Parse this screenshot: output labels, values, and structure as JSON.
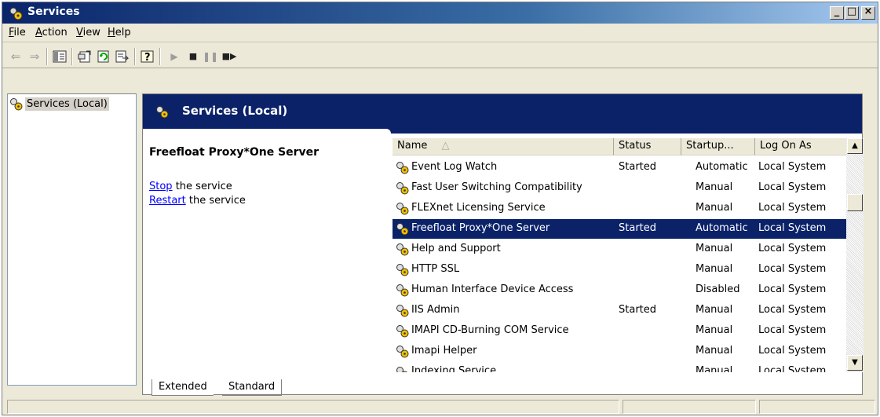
{
  "window": {
    "title": "Services"
  },
  "menu": {
    "items": [
      "File",
      "Action",
      "View",
      "Help"
    ]
  },
  "toolbar": {
    "buttons": [
      "back-arrow",
      "forward-arrow",
      "show-hide-tree",
      "properties",
      "refresh",
      "export-list",
      "help",
      "start-service",
      "stop-service",
      "pause-service",
      "restart-service"
    ]
  },
  "tree": {
    "root_label": "Services (Local)"
  },
  "banner": {
    "title": "Services (Local)"
  },
  "details": {
    "service_name": "Freefloat Proxy*One Server",
    "stop_link": "Stop",
    "stop_suffix": "the service",
    "restart_link": "Restart",
    "restart_suffix": "the service"
  },
  "columns": {
    "name": "Name",
    "status": "Status",
    "startup": "Startup...",
    "logon": "Log On As"
  },
  "services": [
    {
      "name": "Event Log Watch",
      "status": "Started",
      "startup": "Automatic",
      "logon": "Local System"
    },
    {
      "name": "Fast User Switching Compatibility",
      "status": "",
      "startup": "Manual",
      "logon": "Local System"
    },
    {
      "name": "FLEXnet Licensing Service",
      "status": "",
      "startup": "Manual",
      "logon": "Local System"
    },
    {
      "name": "Freefloat Proxy*One Server",
      "status": "Started",
      "startup": "Automatic",
      "logon": "Local System"
    },
    {
      "name": "Help and Support",
      "status": "",
      "startup": "Manual",
      "logon": "Local System"
    },
    {
      "name": "HTTP SSL",
      "status": "",
      "startup": "Manual",
      "logon": "Local System"
    },
    {
      "name": "Human Interface Device Access",
      "status": "",
      "startup": "Disabled",
      "logon": "Local System"
    },
    {
      "name": "IIS Admin",
      "status": "Started",
      "startup": "Manual",
      "logon": "Local System"
    },
    {
      "name": "IMAPI CD-Burning COM Service",
      "status": "",
      "startup": "Manual",
      "logon": "Local System"
    },
    {
      "name": "Imapi Helper",
      "status": "",
      "startup": "Manual",
      "logon": "Local System"
    }
  ],
  "partial_row": {
    "name": "Indexing Service",
    "startup": "Manual",
    "logon": "Local System"
  },
  "tabs": {
    "extended": "Extended",
    "standard": "Standard"
  }
}
